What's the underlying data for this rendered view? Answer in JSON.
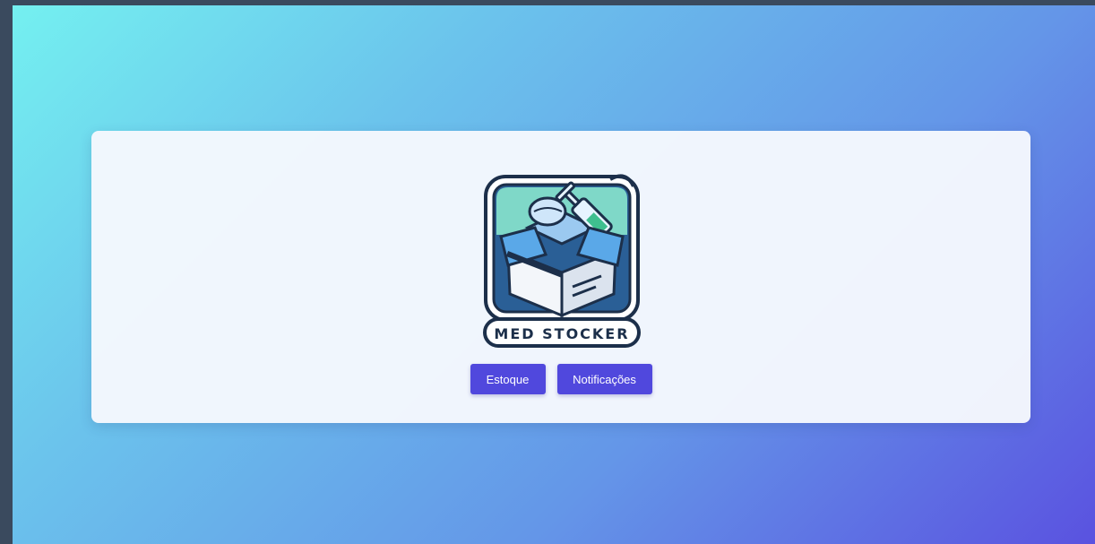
{
  "brand": {
    "logo_text": "MED STOCKER",
    "logo_icon": "medicine-box-icon"
  },
  "actions": {
    "estoque_label": "Estoque",
    "notificacoes_label": "Notificações"
  },
  "colors": {
    "button": "#5048dd",
    "gradient_start": "#74f0f0",
    "gradient_end": "#5a52e0",
    "card": "#f5f8fd"
  }
}
